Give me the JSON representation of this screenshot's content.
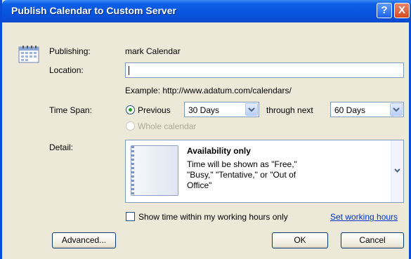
{
  "window": {
    "title": "Publish Calendar to Custom Server",
    "help": "?",
    "close": "X"
  },
  "publishing": {
    "label": "Publishing:",
    "value": "mark Calendar"
  },
  "location": {
    "label": "Location:",
    "value": "",
    "example": "Example: http://www.adatum.com/calendars/"
  },
  "timespan": {
    "label": "Time Span:",
    "previous_label": "Previous",
    "previous_value": "30 Days",
    "through_label": "through next",
    "next_value": "60 Days",
    "whole_label": "Whole calendar"
  },
  "detail": {
    "label": "Detail:",
    "option_title": "Availability only",
    "option_desc": "Time will be shown as \"Free,\" \"Busy,\" \"Tentative,\" or \"Out of Office\""
  },
  "working_hours": {
    "checkbox_label": "Show time within my working hours only",
    "link": "Set working hours",
    "checked": false
  },
  "buttons": {
    "advanced": "Advanced...",
    "ok": "OK",
    "cancel": "Cancel"
  },
  "colors": {
    "title_bar": "#0855dd",
    "dialog_bg": "#ece9d8",
    "link": "#0033cc"
  }
}
